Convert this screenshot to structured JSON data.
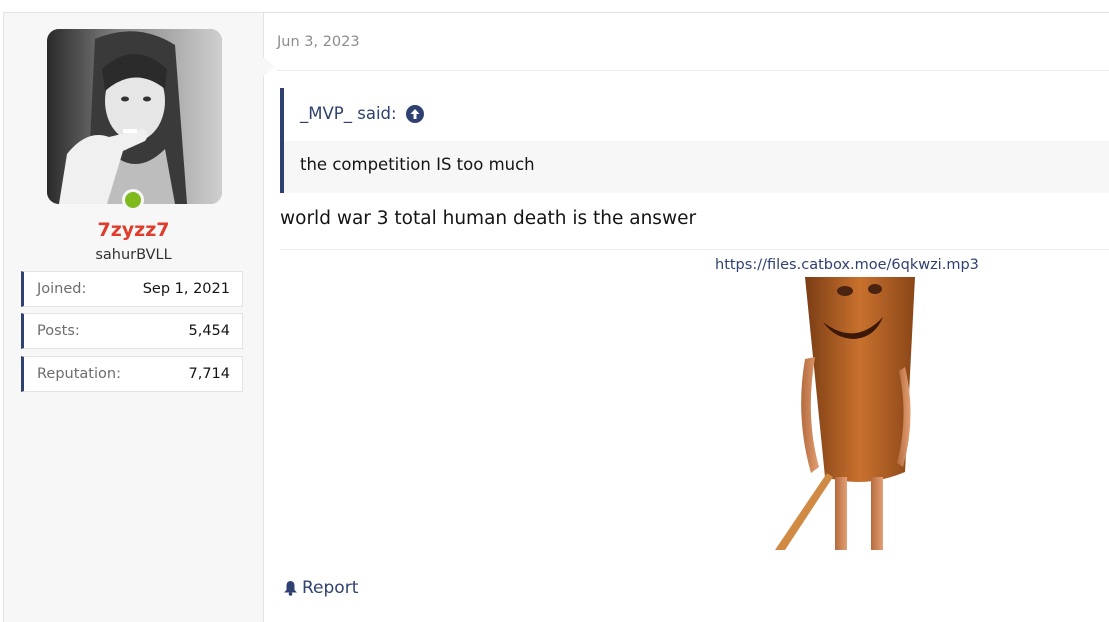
{
  "user": {
    "username": "7zyzz7",
    "title": "sahurBVLL",
    "online": true,
    "stats": [
      {
        "key": "Joined:",
        "value": "Sep 1, 2021"
      },
      {
        "key": "Posts:",
        "value": "5,454"
      },
      {
        "key": "Reputation:",
        "value": "7,714"
      }
    ]
  },
  "post": {
    "date": "Jun 3, 2023",
    "quote": {
      "author": "_MVP_",
      "said_label": "said:",
      "text": "the competition IS too much"
    },
    "message": "world war 3 total human death is the answer",
    "link": "https://files.catbox.moe/6qkwzi.mp3",
    "report_label": "Report"
  },
  "colors": {
    "accent": "#2f4170",
    "username": "#e03b2b",
    "online": "#7fb91c"
  },
  "icons": {
    "quote_jump": "arrow-circle-up-icon",
    "report": "bell-icon"
  }
}
